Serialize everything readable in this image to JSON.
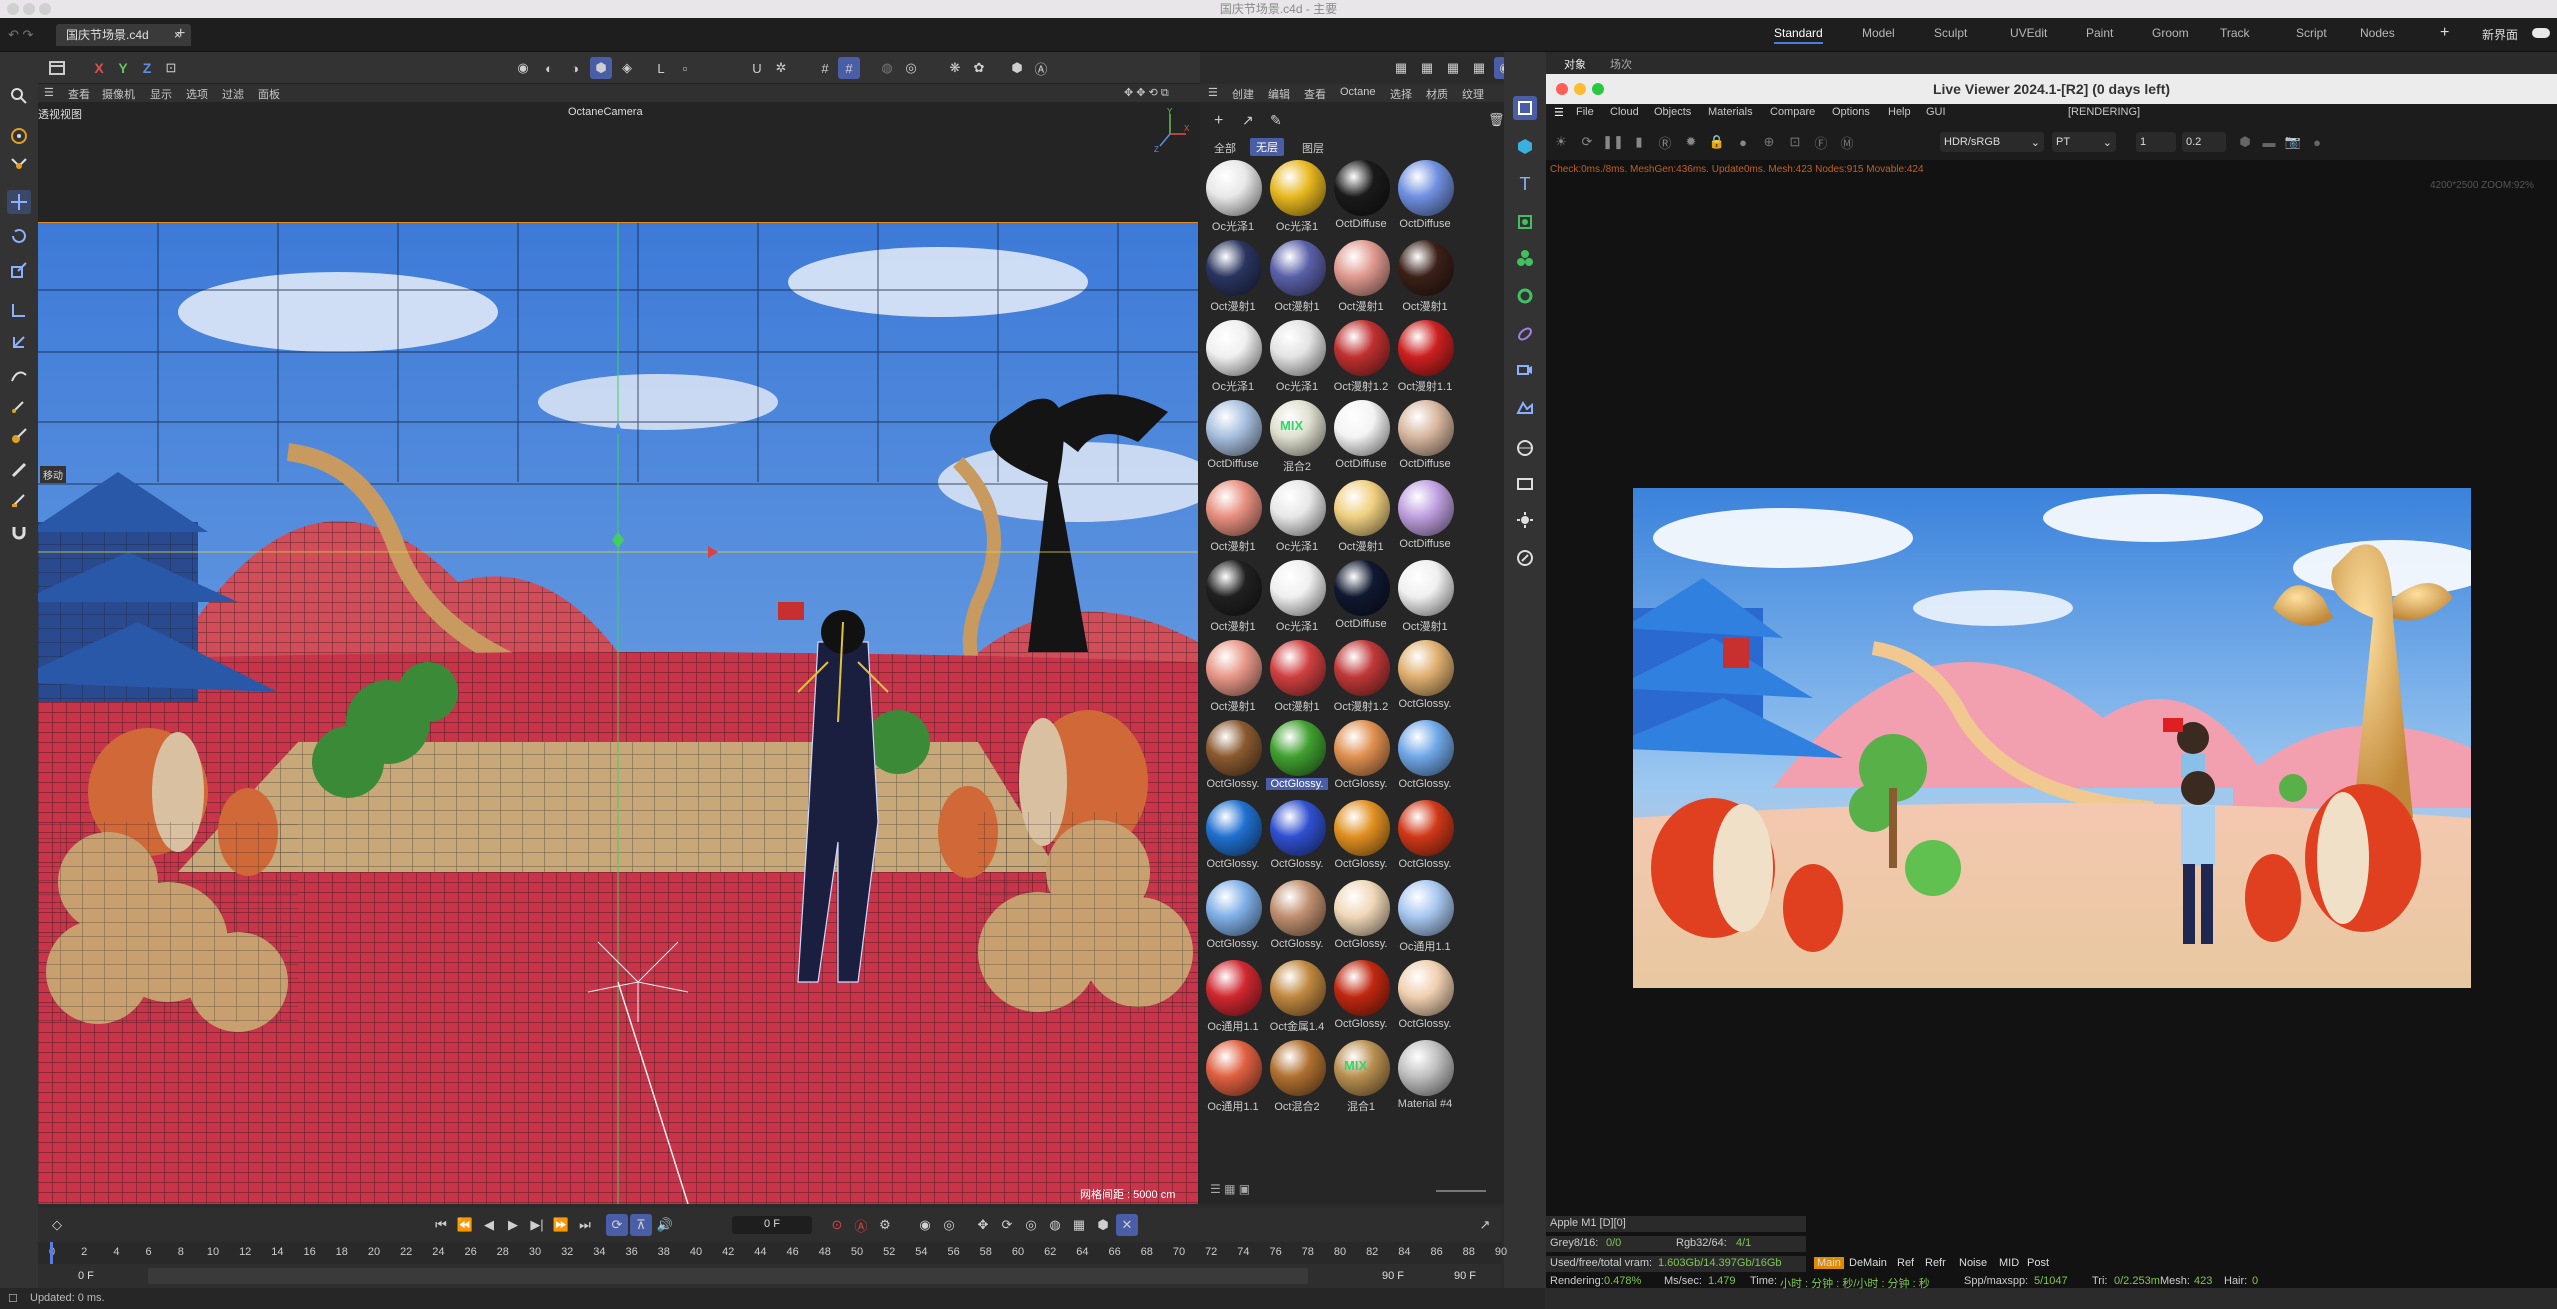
{
  "window": {
    "title": "国庆节场景.c4d - 主要"
  },
  "tabs": {
    "doc": "国庆节场景.c4d",
    "close": "×",
    "add": "+"
  },
  "layouts": [
    "Standard",
    "Model",
    "Sculpt",
    "UVEdit",
    "Paint",
    "Groom",
    "Track",
    "Script",
    "Nodes"
  ],
  "layout_add": "+",
  "new_ui": "新界面",
  "viewport": {
    "axes": [
      "X",
      "Y",
      "Z"
    ],
    "menu": [
      "查看",
      "摄像机",
      "显示",
      "选项",
      "过滤",
      "面板"
    ],
    "view_name": "透视视图",
    "camera": "OctaneCamera",
    "grid_label": "网格间距 : 5000 cm",
    "move_tag": "移动"
  },
  "timeline": {
    "frame": "0 F",
    "ticks": [
      "0",
      "2",
      "4",
      "6",
      "8",
      "10",
      "12",
      "14",
      "16",
      "18",
      "20",
      "22",
      "24",
      "26",
      "28",
      "30",
      "32",
      "34",
      "36",
      "38",
      "40",
      "42",
      "44",
      "46",
      "48",
      "50",
      "52",
      "54",
      "56",
      "58",
      "60",
      "62",
      "64",
      "66",
      "68",
      "70",
      "72",
      "74",
      "76",
      "78",
      "80",
      "82",
      "84",
      "86",
      "88",
      "90"
    ],
    "start": "0 F",
    "start2": "0 F",
    "end": "90 F",
    "end2": "90 F"
  },
  "status": {
    "text": "Updated: 0 ms."
  },
  "materials": {
    "menu": [
      "创建",
      "编辑",
      "查看",
      "Octane",
      "选择",
      "材质",
      "纹理"
    ],
    "filters": [
      "全部",
      "无层",
      "图层"
    ],
    "items": [
      {
        "label": "Oc光泽1",
        "color": "#e8e8e8"
      },
      {
        "label": "Oc光泽1",
        "color": "#e8b820"
      },
      {
        "label": "OctDiffuse",
        "color": "#1a1a1a"
      },
      {
        "label": "OctDiffuse",
        "color": "#7090e0"
      },
      {
        "label": "Oct漫射1",
        "color": "#2a3560"
      },
      {
        "label": "Oct漫射1",
        "color": "#5a60a8"
      },
      {
        "label": "Oct漫射1",
        "color": "#e09a90"
      },
      {
        "label": "Oct漫射1",
        "color": "#3a2018"
      },
      {
        "label": "Oc光泽1",
        "color": "#f0f0f0"
      },
      {
        "label": "Oc光泽1",
        "color": "#e4e4e4"
      },
      {
        "label": "Oct漫射1.2",
        "color": "#c03030"
      },
      {
        "label": "Oct漫射1.1",
        "color": "#cc2020"
      },
      {
        "label": "OctDiffuse",
        "color": "#a8c0e0"
      },
      {
        "label": "混合2",
        "color": "#e0e0d0"
      },
      {
        "label": "OctDiffuse",
        "color": "#f4f4f4"
      },
      {
        "label": "OctDiffuse",
        "color": "#d8b8a0"
      },
      {
        "label": "Oct漫射1",
        "color": "#e89080"
      },
      {
        "label": "Oc光泽1",
        "color": "#e8e8e8"
      },
      {
        "label": "Oct漫射1",
        "color": "#f0d080"
      },
      {
        "label": "OctDiffuse",
        "color": "#c0a0e0"
      },
      {
        "label": "Oct漫射1",
        "color": "#202020"
      },
      {
        "label": "Oc光泽1",
        "color": "#f0f0f0"
      },
      {
        "label": "OctDiffuse",
        "color": "#101830"
      },
      {
        "label": "Oct漫射1",
        "color": "#f0f0f0"
      },
      {
        "label": "Oct漫射1",
        "color": "#e89888"
      },
      {
        "label": "Oct漫射1",
        "color": "#d04040"
      },
      {
        "label": "Oct漫射1.2",
        "color": "#c03838"
      },
      {
        "label": "OctGlossy.",
        "color": "#e0b070"
      },
      {
        "label": "OctGlossy.",
        "color": "#8a5a30"
      },
      {
        "label": "OctGlossy.",
        "color": "#40a030"
      },
      {
        "label": "OctGlossy.",
        "color": "#e09050"
      },
      {
        "label": "OctGlossy.",
        "color": "#70a8e8"
      },
      {
        "label": "OctGlossy.",
        "color": "#2070d0"
      },
      {
        "label": "OctGlossy.",
        "color": "#3050d0"
      },
      {
        "label": "OctGlossy.",
        "color": "#e09020"
      },
      {
        "label": "OctGlossy.",
        "color": "#d03818"
      },
      {
        "label": "OctGlossy.",
        "color": "#80b0e8"
      },
      {
        "label": "OctGlossy.",
        "color": "#c09070"
      },
      {
        "label": "OctGlossy.",
        "color": "#f0d8b8"
      },
      {
        "label": "Oc通用1.1",
        "color": "#a8c8f0"
      },
      {
        "label": "Oc通用1.1",
        "color": "#d02830"
      },
      {
        "label": "Oct金属1.4",
        "color": "#c08840"
      },
      {
        "label": "OctGlossy.",
        "color": "#c02810"
      },
      {
        "label": "OctGlossy.",
        "color": "#f0d0b0"
      },
      {
        "label": "Oc通用1.1",
        "color": "#e06040"
      },
      {
        "label": "Oct混合2",
        "color": "#b07030"
      },
      {
        "label": "混合1",
        "color": "#b89050"
      },
      {
        "label": "Material #4",
        "color": "#c0c0c0"
      }
    ],
    "mix_label": "MIX"
  },
  "panels": {
    "objects": "对象",
    "scene": "场次"
  },
  "liveviewer": {
    "title": "Live Viewer 2024.1-[R2] (0 days left)",
    "menu": [
      "File",
      "Cloud",
      "Objects",
      "Materials",
      "Compare",
      "Options",
      "Help",
      "GUI"
    ],
    "status": "[RENDERING]",
    "colorspace": "HDR/sRGB",
    "kernel": "PT",
    "val1": "1",
    "val2": "0.2",
    "info": "Check:0ms./8ms. MeshGen:436ms. Update0ms. Mesh:423 Nodes:915 Movable:424",
    "resolution": "4200*2500 ZOOM:92%",
    "device": "Apple M1 [D][0]",
    "grey": "Grey8/16:",
    "grey_val": "0/0",
    "rgb": "Rgb32/64:",
    "rgb_val": "4/1",
    "vram": "Used/free/total vram:",
    "vram_val": "1.603Gb/14.397Gb/16Gb",
    "passes": [
      "Main",
      "DeMain",
      "Ref",
      "Refr",
      "Noise",
      "MID",
      "Post"
    ],
    "rendering": "Rendering:",
    "rendering_val": "0.478%",
    "mssec": "Ms/sec:",
    "mssec_val": "1.479",
    "time": "Time:",
    "time_val": "小时 : 分钟 : 秒/小时 : 分钟 : 秒",
    "spp": "Spp/maxspp:",
    "spp_val": "5/1047",
    "tri": "Tri:",
    "tri_val": "0/2.253m",
    "mesh": "Mesh:",
    "mesh_val": "423",
    "hair": "Hair:",
    "hair_val": "0"
  },
  "colors": {
    "accent": "#5a7de0",
    "orange": "#e08a00",
    "green_stat": "#7ec850"
  }
}
